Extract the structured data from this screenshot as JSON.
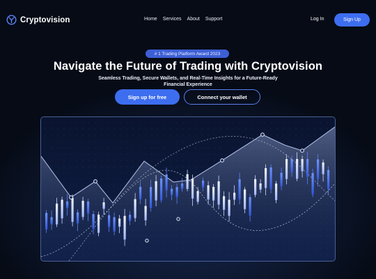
{
  "header": {
    "brand": "Cryptovision",
    "nav": [
      "Home",
      "Services",
      "About",
      "Support"
    ],
    "login_label": "Log In",
    "signup_label": "Sign Up"
  },
  "hero": {
    "badge": "# 1 Trading Platform Award 2023",
    "title": "Navigate the Future of Trading with Cryptovision",
    "subtitle": "Seamless Trading, Secure Wallets, and Real-Time Insights for a Future-Ready Financial Experience",
    "primary_cta": "Sign up for free",
    "secondary_cta": "Connect your wallet"
  },
  "colors": {
    "background": "#060b16",
    "accent": "#3d6ef0",
    "candle_light": "#dfe6ff",
    "candle_blue": "#4f7cf2"
  },
  "icons": {
    "brand": "cryptovision-logo-icon"
  }
}
